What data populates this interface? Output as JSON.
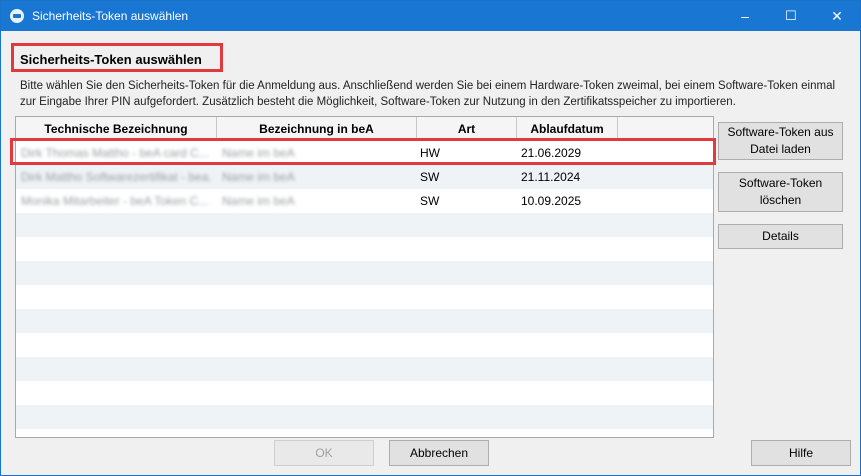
{
  "window": {
    "title": "Sicherheits-Token auswählen",
    "icon": "bea-app-icon",
    "controls": {
      "minimize": "–",
      "maximize": "☐",
      "close": "✕"
    }
  },
  "header": {
    "title": "Sicherheits-Token auswählen",
    "description": "Bitte wählen Sie den Sicherheits-Token für die Anmeldung aus. Anschließend werden Sie bei einem Hardware-Token zweimal, bei einem Software-Token einmal zur Eingabe Ihrer PIN aufgefordert. Zusätzlich besteht die Möglichkeit, Software-Token zur Nutzung in den Zertifikatsspeicher zu importieren."
  },
  "table": {
    "columns": [
      "Technische Bezeichnung",
      "Bezeichnung in beA",
      "Art",
      "Ablaufdatum"
    ],
    "rows": [
      {
        "technical": "Dirk Thomas Mattho - beA card C...",
        "bea_name": "Name im beA",
        "type": "HW",
        "expiry": "21.06.2029",
        "selected": true
      },
      {
        "technical": "Dirk Mattho Softwarezertifikat - bea...",
        "bea_name": "Name im beA",
        "type": "SW",
        "expiry": "21.11.2024",
        "selected": false
      },
      {
        "technical": "Monika Mitarbeiter - beA Token C...",
        "bea_name": "Name im beA",
        "type": "SW",
        "expiry": "10.09.2025",
        "selected": false
      }
    ]
  },
  "side_buttons": {
    "load": "Software-Token aus Datei laden",
    "delete": "Software-Token löschen",
    "details": "Details"
  },
  "footer": {
    "ok": "OK",
    "cancel": "Abbrechen",
    "help": "Hilfe"
  }
}
